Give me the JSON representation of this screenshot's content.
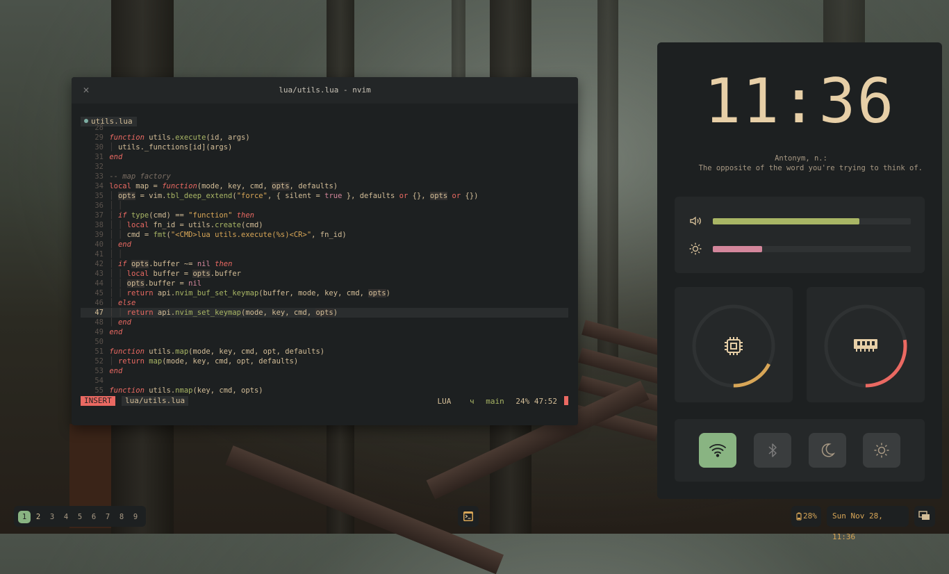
{
  "editor": {
    "title": "lua/utils.lua - nvim",
    "tab": "utils.lua",
    "status": {
      "mode": "INSERT",
      "file": "lua/utils.lua",
      "filetype": "LUA",
      "branch": "main",
      "branch_icon": "ч",
      "position": "24% 47:52"
    }
  },
  "panel": {
    "time": "11:36",
    "quote_title": "Antonym, n.:",
    "quote_text": "The opposite of the word you're trying to think of.",
    "volume": 0.74,
    "brightness": 0.25,
    "cpu_usage": 0.35,
    "ram_usage": 0.55,
    "toggles": [
      {
        "name": "wifi",
        "icon": "wifi-icon",
        "on": true
      },
      {
        "name": "bluetooth",
        "icon": "bluetooth-icon",
        "on": false
      },
      {
        "name": "night-mode",
        "icon": "moon-icon",
        "on": false
      },
      {
        "name": "theme",
        "icon": "sun-icon",
        "on": false
      }
    ]
  },
  "bar": {
    "workspaces": [
      "1",
      "2",
      "3",
      "4",
      "5",
      "6",
      "7",
      "8",
      "9"
    ],
    "active_workspace": "1",
    "battery": "28%",
    "datetime": "Sun Nov 28, 11:36"
  },
  "colors": {
    "accent_green": "#89b482",
    "volume_fill": "#a9b665",
    "brightness_fill": "#d3869b",
    "cpu_arc": "#d8a657",
    "ram_arc": "#ea6962",
    "insert_mode": "#ea6962"
  }
}
